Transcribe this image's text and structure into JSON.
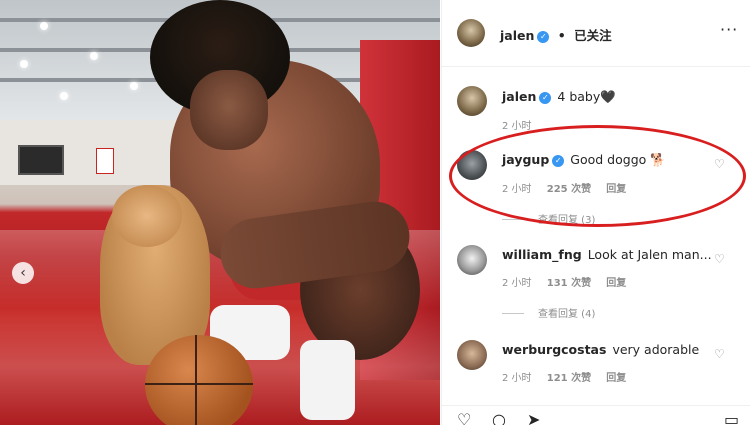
{
  "header": {
    "username": "jalen",
    "separator": "•",
    "follow_status": "已关注",
    "more": "···"
  },
  "caption": {
    "username": "jalen",
    "text": "4 baby🖤",
    "time": "2 小时"
  },
  "comments": [
    {
      "username": "jaygup",
      "verified": true,
      "text": "Good doggo 🐕",
      "time": "2 小时",
      "likes": "225 次赞",
      "reply": "回复",
      "view_replies": "查看回复 (3)"
    },
    {
      "username": "william_fng",
      "verified": false,
      "text": "Look at Jalen man...",
      "time": "2 小时",
      "likes": "131 次赞",
      "reply": "回复",
      "view_replies": "查看回复 (4)"
    },
    {
      "username": "werburgcostas",
      "verified": false,
      "text": "very adorable",
      "time": "2 小时",
      "likes": "121 次赞",
      "reply": "回复"
    }
  ],
  "icons": {
    "verified": "✓",
    "heart": "♡",
    "prev": "‹"
  },
  "colors": {
    "highlight": "#d81e1e",
    "verified": "#3897f0"
  }
}
